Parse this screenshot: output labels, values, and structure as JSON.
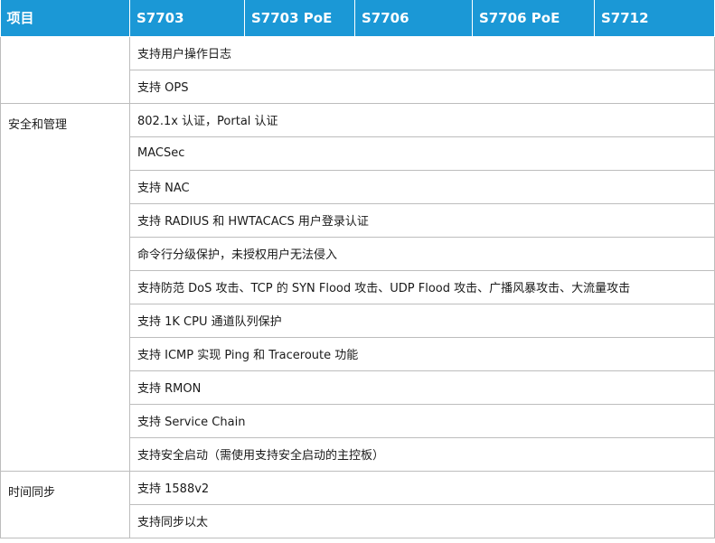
{
  "header": [
    "项目",
    "S7703",
    "S7703 PoE",
    "S7706",
    "S7706 PoE",
    "S7712"
  ],
  "sections": [
    {
      "category": "",
      "features": [
        "支持用户操作日志",
        "支持 OPS"
      ]
    },
    {
      "category": "安全和管理",
      "features": [
        "802.1x 认证，Portal 认证",
        "MACSec",
        "支持 NAC",
        "支持 RADIUS 和 HWTACACS 用户登录认证",
        "命令行分级保护，未授权用户无法侵入",
        "支持防范 DoS 攻击、TCP 的 SYN Flood 攻击、UDP Flood 攻击、广播风暴攻击、大流量攻击",
        "支持 1K CPU 通道队列保护",
        "支持 ICMP 实现 Ping 和 Traceroute 功能",
        "支持 RMON",
        "支持 Service Chain",
        "支持安全启动（需使用支持安全启动的主控板）"
      ]
    },
    {
      "category": "时间同步",
      "features": [
        "支持 1588v2",
        "支持同步以太"
      ]
    }
  ]
}
